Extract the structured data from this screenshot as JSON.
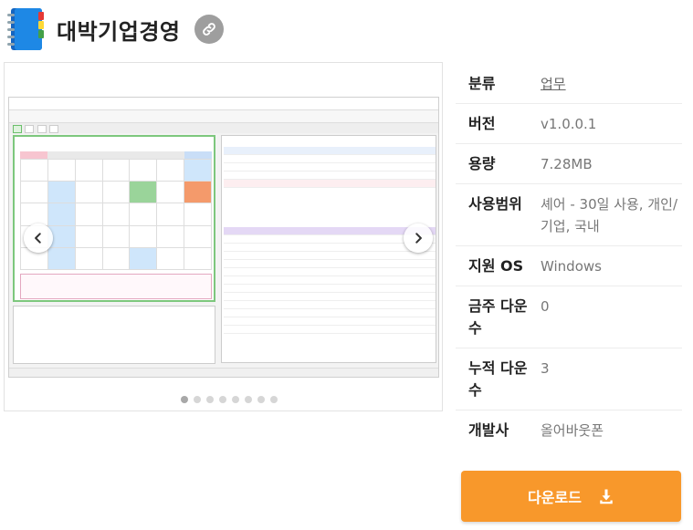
{
  "app": {
    "title": "대박기업경영",
    "icon": "address-book-icon",
    "link_icon": "link-icon"
  },
  "gallery": {
    "total_slides": 8,
    "active_slide": 1
  },
  "info": {
    "rows": [
      {
        "label": "분류",
        "value": "업무",
        "is_link": true
      },
      {
        "label": "버전",
        "value": "v1.0.0.1"
      },
      {
        "label": "용량",
        "value": "7.28MB"
      },
      {
        "label": "사용범위",
        "value": "셰어 - 30일 사용, 개인/기업, 국내"
      },
      {
        "label": "지원 OS",
        "value": "Windows"
      },
      {
        "label": "금주 다운수",
        "value": "0"
      },
      {
        "label": "누적 다운수",
        "value": "3"
      },
      {
        "label": "개발사",
        "value": "올어바웃폰"
      }
    ]
  },
  "download": {
    "label": "다운로드",
    "icon": "download-icon"
  },
  "colors": {
    "accent": "#f8982b",
    "link_btn": "#9e9e9e"
  }
}
